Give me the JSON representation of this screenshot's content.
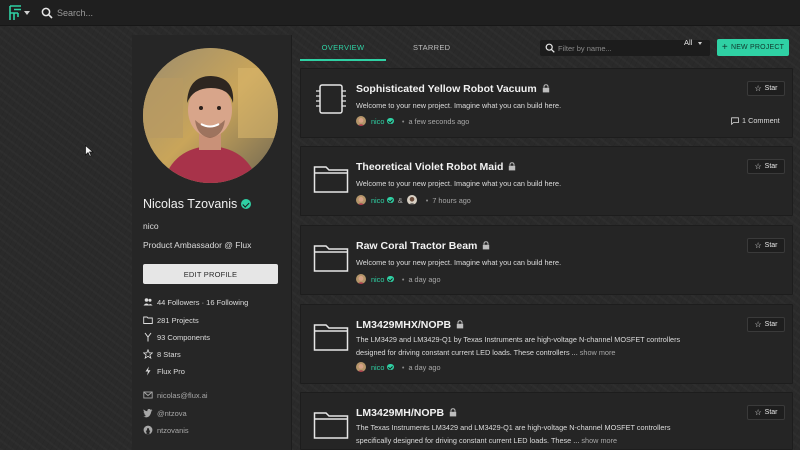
{
  "topbar": {
    "search_placeholder": "Search...",
    "icons": [
      "flux-logo-icon",
      "caret-down-icon",
      "search-icon"
    ]
  },
  "profile": {
    "name": "Nicolas Tzovanis",
    "handle": "nico",
    "role": "Product Ambassador @ Flux",
    "edit_label": "EDIT PROFILE",
    "followers": "44 Followers · 16 Following",
    "projects": "281 Projects",
    "components": "93 Components",
    "stars": "8 Stars",
    "plan": "Flux Pro",
    "email": "nicolas@flux.ai",
    "twitter": "@ntzova",
    "github": "ntzovanis"
  },
  "tabs": {
    "overview": "OVERVIEW",
    "starred": "STARRED",
    "filter_placeholder": "Filter by name...",
    "filter_value": "All",
    "new_project": "NEW PROJECT"
  },
  "colors": {
    "accent": "#2fd1a4",
    "panel": "#262626",
    "topbar": "#1f1f1f"
  },
  "projects": [
    {
      "title": "Sophisticated Yellow Robot Vacuum",
      "icon": "chip-icon",
      "desc": "Welcome to your new project. Imagine what you can build here.",
      "author": "nico",
      "time": "a few seconds ago",
      "star": "Star",
      "comments": "1 Comment"
    },
    {
      "title": "Theoretical Violet Robot Maid",
      "icon": "folder-icon",
      "desc": "Welcome to your new project. Imagine what you can build here.",
      "author": "nico",
      "amp": "&",
      "time": "7 hours ago",
      "star": "Star"
    },
    {
      "title": "Raw Coral Tractor Beam",
      "icon": "folder-icon",
      "desc": "Welcome to your new project. Imagine what you can build here.",
      "author": "nico",
      "time": "a day ago",
      "star": "Star"
    },
    {
      "title": "LM3429MHX/NOPB",
      "icon": "folder-icon",
      "desc": "The LM3429 and LM3429-Q1 by Texas Instruments are high-voltage N-channel MOSFET controllers designed for driving constant current LED loads. These controllers ...",
      "show_more": "show more",
      "author": "nico",
      "time": "a day ago",
      "star": "Star"
    },
    {
      "title": "LM3429MH/NOPB",
      "icon": "folder-icon",
      "desc": "The Texas Instruments LM3429 and LM3429-Q1 are high-voltage N-channel MOSFET controllers specifically designed for driving constant current LED loads. These ...",
      "show_more": "show more",
      "star": "Star"
    }
  ]
}
